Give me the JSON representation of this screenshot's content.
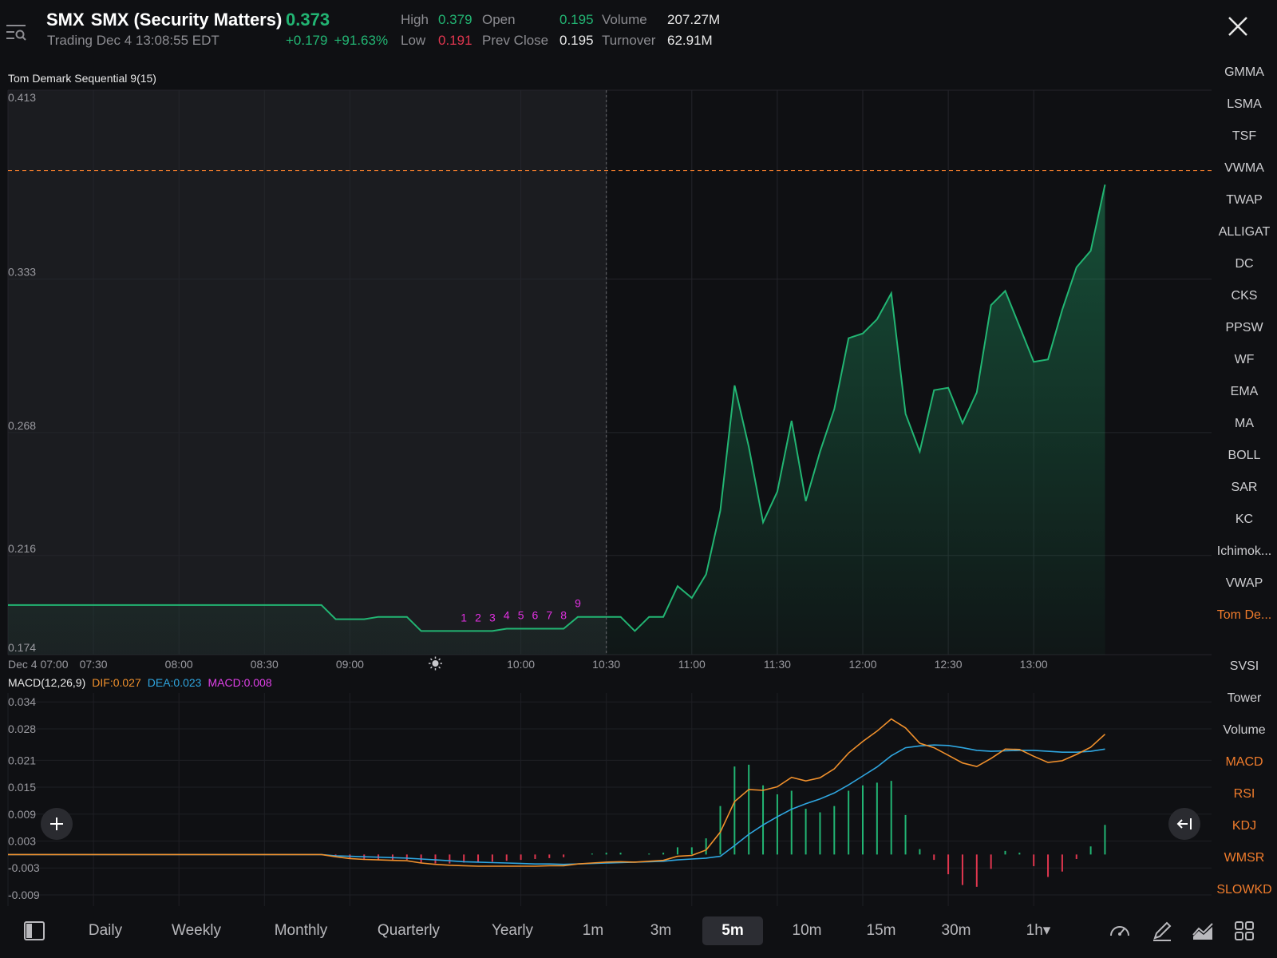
{
  "header": {
    "symbol": "SMX",
    "name": "SMX (Security Matters)",
    "price": "0.373",
    "trading": "Trading Dec 4 13:08:55 EDT",
    "change": "+0.179",
    "change_pct": "+91.63%",
    "high_label": "High",
    "high": "0.379",
    "low_label": "Low",
    "low": "0.191",
    "open_label": "Open",
    "open": "0.195",
    "prev_close_label": "Prev Close",
    "prev_close": "0.195",
    "volume_label": "Volume",
    "volume": "207.27M",
    "turnover_label": "Turnover",
    "turnover": "62.91M"
  },
  "colors": {
    "up": "#22b573",
    "down": "#e0364f",
    "accent": "#f07c2c",
    "dif": "#f0902c",
    "dea": "#2fa6e0",
    "macd": "#e040e8",
    "td": "#e030e0"
  },
  "icons": [
    "menu-search-icon",
    "close-icon",
    "plus-icon",
    "collapse-left-icon",
    "panel-icon",
    "speedometer-icon",
    "pen-icon",
    "chart-type-icon",
    "grid-icon"
  ],
  "indicator_label": "Tom Demark Sequential 9(15)",
  "macd_legend": {
    "title": "MACD(12,26,9)",
    "dif": "DIF:0.027",
    "dea": "DEA:0.023",
    "macd": "MACD:0.008"
  },
  "sidebar": {
    "main": [
      "GMMA",
      "LSMA",
      "TSF",
      "VWMA",
      "TWAP",
      "ALLIGAT",
      "DC",
      "CKS",
      "PPSW",
      "WF",
      "EMA",
      "MA",
      "BOLL",
      "SAR",
      "KC",
      "Ichimok...",
      "VWAP",
      "Tom De..."
    ],
    "main_active": "Tom De...",
    "sub": [
      "SVSI",
      "Tower",
      "Volume",
      "MACD",
      "RSI",
      "KDJ",
      "WMSR",
      "SLOWKD"
    ],
    "sub_active": [
      "MACD",
      "RSI",
      "KDJ",
      "WMSR",
      "SLOWKD"
    ]
  },
  "timeframes": [
    "Daily",
    "Weekly",
    "Monthly",
    "Quarterly",
    "Yearly",
    "1m",
    "3m",
    "5m",
    "10m",
    "15m",
    "30m",
    "1h"
  ],
  "timeframe_active": "5m",
  "timeframe_more_glyph": "▾",
  "chart_data": [
    {
      "type": "area",
      "title": "Tom Demark Sequential 9(15)",
      "x_start": "Dec 4 07:00",
      "x_interval": "5m",
      "x_tick_labels": [
        "Dec 4 07:00",
        "07:30",
        "08:00",
        "08:30",
        "09:00",
        "10:00",
        "10:30",
        "11:00",
        "11:30",
        "12:00",
        "12:30",
        "13:00"
      ],
      "y_tick_labels": [
        "0.413",
        "0.333",
        "0.268",
        "0.216",
        "0.174"
      ],
      "ylim": [
        0.174,
        0.413
      ],
      "premarket_shaded_until": "10:30",
      "reference_line": 0.379,
      "values": [
        0.195,
        0.195,
        0.195,
        0.195,
        0.195,
        0.195,
        0.195,
        0.195,
        0.195,
        0.195,
        0.195,
        0.195,
        0.195,
        0.195,
        0.195,
        0.195,
        0.195,
        0.195,
        0.195,
        0.195,
        0.195,
        0.195,
        0.195,
        0.189,
        0.189,
        0.189,
        0.19,
        0.19,
        0.19,
        0.184,
        0.184,
        0.184,
        0.184,
        0.184,
        0.184,
        0.185,
        0.185,
        0.185,
        0.185,
        0.185,
        0.19,
        0.19,
        0.19,
        0.19,
        0.184,
        0.19,
        0.19,
        0.203,
        0.198,
        0.208,
        0.235,
        0.288,
        0.262,
        0.23,
        0.243,
        0.273,
        0.239,
        0.26,
        0.278,
        0.308,
        0.31,
        0.316,
        0.327,
        0.276,
        0.26,
        0.286,
        0.287,
        0.272,
        0.285,
        0.322,
        0.328,
        0.313,
        0.298,
        0.299,
        0.32,
        0.338,
        0.345,
        0.373
      ],
      "td_setup_labels": [
        "1",
        "2",
        "3",
        "4",
        "5",
        "6",
        "7",
        "8",
        "9"
      ]
    },
    {
      "type": "bar",
      "title": "MACD(12,26,9)",
      "y_tick_labels": [
        "0.034",
        "0.028",
        "0.021",
        "0.015",
        "0.009",
        "0.003",
        "-0.003",
        "-0.009"
      ],
      "ylim": [
        -0.0115,
        0.036
      ],
      "series": [
        {
          "name": "DIF",
          "values": [
            0,
            0,
            0,
            0,
            0,
            0,
            0,
            0,
            0,
            0,
            0,
            0,
            0,
            0,
            0,
            0,
            0,
            0,
            0,
            0,
            0,
            0,
            0,
            -0.0005,
            -0.0009,
            -0.0011,
            -0.0012,
            -0.0013,
            -0.0014,
            -0.0019,
            -0.0022,
            -0.0024,
            -0.0025,
            -0.0026,
            -0.0026,
            -0.0026,
            -0.0026,
            -0.0026,
            -0.0025,
            -0.0025,
            -0.0021,
            -0.0019,
            -0.0017,
            -0.0016,
            -0.0017,
            -0.0015,
            -0.0013,
            -0.0004,
            -0.0002,
            0.001,
            0.005,
            0.0118,
            0.0145,
            0.0143,
            0.0151,
            0.0172,
            0.0164,
            0.0171,
            0.0191,
            0.0226,
            0.0252,
            0.0275,
            0.0302,
            0.0282,
            0.0248,
            0.0238,
            0.0221,
            0.0204,
            0.0196,
            0.0214,
            0.0235,
            0.0234,
            0.0219,
            0.0205,
            0.0209,
            0.0223,
            0.0239,
            0.0268
          ]
        },
        {
          "name": "DEA",
          "values": [
            0,
            0,
            0,
            0,
            0,
            0,
            0,
            0,
            0,
            0,
            0,
            0,
            0,
            0,
            0,
            0,
            0,
            0,
            0,
            0,
            0,
            0,
            0,
            -0.0003,
            -0.0004,
            -0.0005,
            -0.0006,
            -0.0007,
            -0.0008,
            -0.001,
            -0.0012,
            -0.0014,
            -0.0016,
            -0.0017,
            -0.0018,
            -0.0019,
            -0.002,
            -0.0021,
            -0.0021,
            -0.0022,
            -0.0021,
            -0.002,
            -0.0019,
            -0.0018,
            -0.0017,
            -0.0016,
            -0.0015,
            -0.0012,
            -0.001,
            -0.0008,
            -0.0004,
            0.002,
            0.0045,
            0.0066,
            0.0084,
            0.0101,
            0.0113,
            0.0124,
            0.0137,
            0.0155,
            0.0175,
            0.0195,
            0.022,
            0.0238,
            0.0242,
            0.0244,
            0.0243,
            0.0238,
            0.0232,
            0.023,
            0.0231,
            0.0232,
            0.0232,
            0.023,
            0.0228,
            0.0228,
            0.023,
            0.0235
          ]
        },
        {
          "name": "MACD",
          "values": [
            0,
            0,
            0,
            0,
            0,
            0,
            0,
            0,
            0,
            0,
            0,
            0,
            0,
            0,
            0,
            0,
            0,
            0,
            0,
            0,
            0,
            0,
            0,
            -0.0004,
            -0.0009,
            -0.0012,
            -0.0012,
            -0.0012,
            -0.0012,
            -0.0018,
            -0.002,
            -0.002,
            -0.0018,
            -0.0018,
            -0.0016,
            -0.0014,
            -0.0012,
            -0.001,
            -0.0008,
            -0.0006,
            0,
            0.0002,
            0.0004,
            0.0004,
            0,
            0.0002,
            0.0004,
            0.0016,
            0.0016,
            0.0036,
            0.0108,
            0.0196,
            0.02,
            0.0154,
            0.0134,
            0.0142,
            0.0102,
            0.0094,
            0.0108,
            0.0142,
            0.0154,
            0.016,
            0.0164,
            0.0088,
            0.0012,
            -0.0012,
            -0.0044,
            -0.0068,
            -0.0072,
            -0.0032,
            0.0008,
            0.0004,
            -0.0026,
            -0.005,
            -0.0038,
            -0.001,
            0.0018,
            0.0066
          ]
        }
      ]
    }
  ]
}
